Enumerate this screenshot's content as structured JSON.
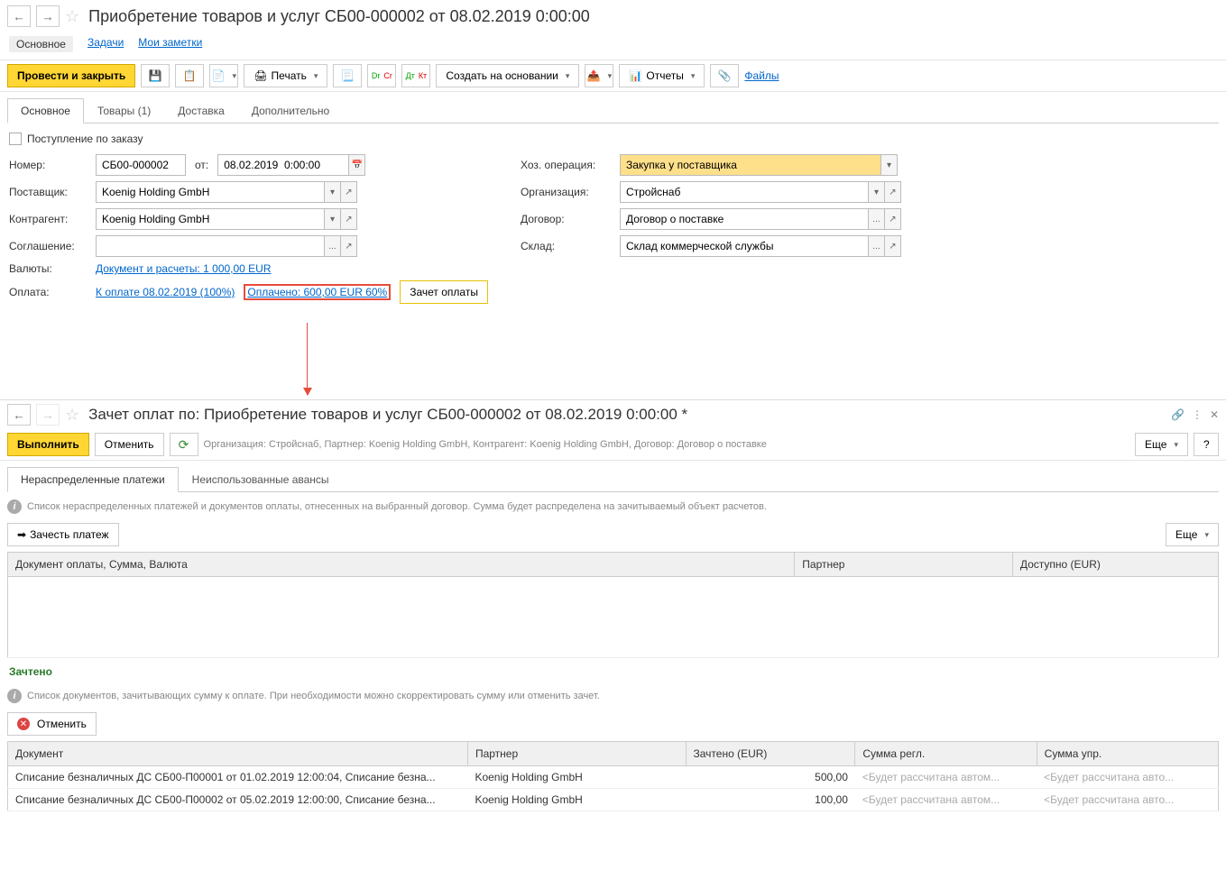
{
  "top": {
    "title": "Приобретение товаров и услуг СБ00-000002 от 08.02.2019 0:00:00",
    "subtabs": {
      "main": "Основное",
      "tasks": "Задачи",
      "notes": "Мои заметки"
    },
    "toolbar": {
      "post_close": "Провести и закрыть",
      "print": "Печать",
      "create_based": "Создать на основании",
      "reports": "Отчеты",
      "files": "Файлы"
    },
    "tabs": {
      "main": "Основное",
      "goods": "Товары (1)",
      "delivery": "Доставка",
      "extra": "Дополнительно"
    },
    "form": {
      "by_order": "Поступление по заказу",
      "number_lbl": "Номер:",
      "number": "СБ00-000002",
      "from": "от:",
      "date": "08.02.2019  0:00:00",
      "op_lbl": "Хоз. операция:",
      "op": "Закупка у поставщика",
      "supplier_lbl": "Поставщик:",
      "supplier": "Koenig Holding GmbH",
      "org_lbl": "Организация:",
      "org": "Стройснаб",
      "contr_lbl": "Контрагент:",
      "contr": "Koenig Holding GmbH",
      "contract_lbl": "Договор:",
      "contract": "Договор о поставке",
      "agree_lbl": "Соглашение:",
      "agree": "",
      "wh_lbl": "Склад:",
      "wh": "Склад коммерческой службы",
      "curr_lbl": "Валюты:",
      "curr_link": "Документ и расчеты: 1 000,00 EUR",
      "pay_lbl": "Оплата:",
      "pay1": "К оплате 08.02.2019 (100%)",
      "pay2": "Оплачено: 600,00 EUR 60%",
      "pay_btn": "Зачет оплаты"
    }
  },
  "bottom": {
    "title": "Зачет оплат по: Приобретение товаров и услуг СБ00-000002 от 08.02.2019 0:00:00 *",
    "run": "Выполнить",
    "cancel": "Отменить",
    "more": "Еще",
    "context": "Организация: Стройснаб, Партнер: Koenig Holding GmbH, Контрагент: Koenig Holding GmbH, Договор: Договор о поставке",
    "tabs": {
      "unalloc": "Нераспределенные платежи",
      "unused": "Неиспользованные авансы"
    },
    "hint1": "Список нераспределенных платежей и документов оплаты, отнесенных на выбранный договор. Сумма будет распределена на зачитываемый объект расчетов.",
    "credit_btn": "Зачесть платеж",
    "cols1": {
      "doc": "Документ оплаты, Сумма, Валюта",
      "partner": "Партнер",
      "avail": "Доступно (EUR)"
    },
    "credited_lbl": "Зачтено",
    "hint2": "Список документов, зачитывающих сумму к оплате. При необходимости можно скорректировать сумму или отменить зачет.",
    "cancel2": "Отменить",
    "cols2": {
      "doc": "Документ",
      "partner": "Партнер",
      "credited": "Зачтено (EUR)",
      "regl": "Сумма регл.",
      "mgmt": "Сумма упр."
    },
    "rows": [
      {
        "doc": "Списание безналичных ДС СБ00-П00001 от 01.02.2019 12:00:04, Списание безна...",
        "partner": "Koenig Holding GmbH",
        "credited": "500,00",
        "regl": "<Будет рассчитана автом...",
        "mgmt": "<Будет рассчитана авто..."
      },
      {
        "doc": "Списание безналичных ДС СБ00-П00002 от 05.02.2019 12:00:00, Списание безна...",
        "partner": "Koenig Holding GmbH",
        "credited": "100,00",
        "regl": "<Будет рассчитана автом...",
        "mgmt": "<Будет рассчитана авто..."
      }
    ]
  }
}
